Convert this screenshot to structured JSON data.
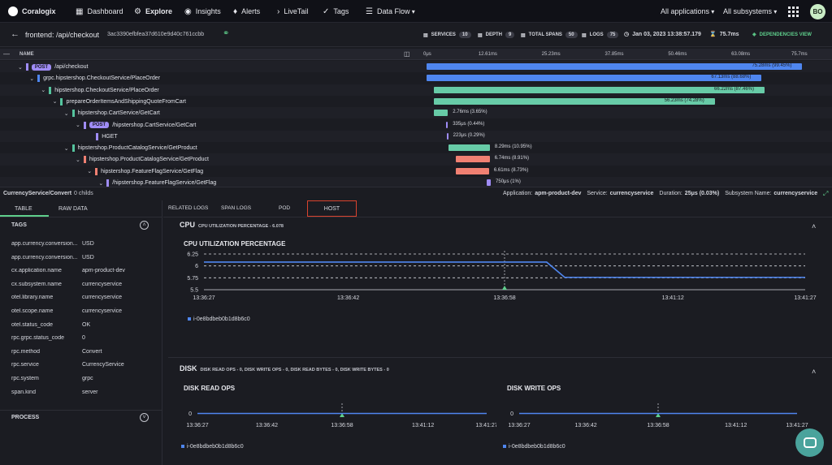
{
  "nav": {
    "brand": "Coralogix",
    "items": [
      "Dashboard",
      "Explore",
      "Insights",
      "Alerts",
      "LiveTail",
      "Tags",
      "Data Flow"
    ],
    "app_select": "All applications",
    "subsys_select": "All subsystems",
    "avatar": "BO"
  },
  "trace": {
    "title": "frontend: /api/checkout",
    "trace_id": "3ac3390efbfea37d610e9d40c761ccbb",
    "services_label": "SERVICES",
    "services": "10",
    "depth_label": "DEPTH",
    "depth": "9",
    "spans_label": "TOTAL SPANS",
    "spans": "50",
    "logs_label": "LOGS",
    "logs": "75",
    "date": "Jan 03, 2023 13:38:57.179",
    "duration": "75.7ms",
    "deps_view": "DEPENDENCIES VIEW"
  },
  "timeline": {
    "name_header": "NAME",
    "ticks": [
      "0μs",
      "12.61ms",
      "25.23ms",
      "37.85ms",
      "50.46ms",
      "63.08ms",
      "75.7ms"
    ],
    "rows": [
      {
        "name": "/api/checkout",
        "method": "POST",
        "color": "#9f8cf5",
        "indent": 0,
        "start": 0.0,
        "width": 0.9945,
        "bar": "#4f86ef",
        "label": "75.28ms (99.45%)",
        "label_inside": true,
        "chevron": true
      },
      {
        "name": "grpc.hipstershop.CheckoutService/PlaceOrder",
        "color": "#4f86ef",
        "indent": 1,
        "start": 0.0,
        "width": 0.8868,
        "bar": "#4f86ef",
        "label": "67.13ms (88.68%)",
        "label_inside": true,
        "chevron": true
      },
      {
        "name": "hipstershop.CheckoutService/PlaceOrder",
        "color": "#55c49e",
        "indent": 2,
        "start": 0.02,
        "width": 0.8746,
        "bar": "#67cba7",
        "label": "66.22ms (87.46%)",
        "label_inside": true,
        "chevron": true
      },
      {
        "name": "prepareOrderItemsAndShippingQuoteFromCart",
        "color": "#55c49e",
        "indent": 3,
        "start": 0.02,
        "width": 0.7428,
        "bar": "#67cba7",
        "label": "56.23ms (74.28%)",
        "label_inside": true,
        "chevron": true
      },
      {
        "name": "hipstershop.CartService/GetCart",
        "color": "#55c49e",
        "indent": 4,
        "start": 0.02,
        "width": 0.0365,
        "bar": "#67cba7",
        "label": "2.76ms (3.65%)",
        "label_inside": false,
        "chevron": true
      },
      {
        "name": "/hipstershop.CartService/GetCart",
        "method": "POST",
        "color": "#9f8cf5",
        "indent": 5,
        "start": 0.052,
        "width": 0.0044,
        "bar": "#9f8cf5",
        "label": "335μs (0.44%)",
        "label_inside": false,
        "chevron": true
      },
      {
        "name": "HGET",
        "color": "#9f8cf5",
        "indent": 6,
        "start": 0.053,
        "width": 0.0029,
        "bar": "#9f8cf5",
        "label": "223μs (0.29%)",
        "label_inside": false,
        "chevron": false
      },
      {
        "name": "hipstershop.ProductCatalogService/GetProduct",
        "color": "#55c49e",
        "indent": 4,
        "start": 0.058,
        "width": 0.1095,
        "bar": "#67cba7",
        "label": "8.29ms (10.95%)",
        "label_inside": false,
        "chevron": true
      },
      {
        "name": "hipstershop.ProductCatalogService/GetProduct",
        "color": "#f08072",
        "indent": 5,
        "start": 0.078,
        "width": 0.0891,
        "bar": "#f08072",
        "label": "6.74ms (8.91%)",
        "label_inside": false,
        "chevron": true
      },
      {
        "name": "hipstershop.FeatureFlagService/GetFlag",
        "color": "#f08072",
        "indent": 6,
        "start": 0.078,
        "width": 0.0873,
        "bar": "#f08072",
        "label": "6.61ms (8.73%)",
        "label_inside": false,
        "chevron": true
      },
      {
        "name": "/hipstershop.FeatureFlagService/GetFlag",
        "color": "#9f8cf5",
        "indent": 7,
        "start": 0.16,
        "width": 0.01,
        "bar": "#9f8cf5",
        "label": "750μs (1%)",
        "label_inside": false,
        "chevron": true
      }
    ]
  },
  "info": {
    "span": "CurrencyService/Convert",
    "childs": "0 childs",
    "app_label": "Application:",
    "app": "apm-product-dev",
    "svc_label": "Service:",
    "svc": "currencyservice",
    "dur_label": "Duration:",
    "dur": "25μs (0.03%)",
    "sub_label": "Subsystem Name:",
    "sub": "currencyservice"
  },
  "left": {
    "tabs": [
      "TABLE",
      "RAW DATA"
    ],
    "tags_title": "TAGS",
    "tags": [
      {
        "k": "app.currency.conversion...",
        "v": "USD"
      },
      {
        "k": "app.currency.conversion...",
        "v": "USD"
      },
      {
        "k": "cx.application.name",
        "v": "apm-product-dev"
      },
      {
        "k": "cx.subsystem.name",
        "v": "currencyservice"
      },
      {
        "k": "otel.library.name",
        "v": "currencyservice"
      },
      {
        "k": "otel.scope.name",
        "v": "currencyservice"
      },
      {
        "k": "otel.status_code",
        "v": "OK"
      },
      {
        "k": "rpc.grpc.status_code",
        "v": "0"
      },
      {
        "k": "rpc.method",
        "v": "Convert"
      },
      {
        "k": "rpc.service",
        "v": "CurrencyService"
      },
      {
        "k": "rpc.system",
        "v": "grpc"
      },
      {
        "k": "span.kind",
        "v": "server"
      }
    ],
    "process_title": "PROCESS"
  },
  "right": {
    "tabs": [
      "RELATED LOGS",
      "SPAN LOGS",
      "POD",
      "HOST"
    ],
    "cpu": {
      "title": "CPU",
      "subtitle": "CPU UTILIZATION PERCENTAGE - 6.078",
      "chart_title": "CPU UTILIZATION PERCENTAGE"
    },
    "disk": {
      "title": "DISK",
      "subtitle": "DISK READ OPS - 0, DISK WRITE OPS - 0, DISK READ BYTES - 0, DISK WRITE BYTES - 0",
      "read_title": "DISK READ OPS",
      "write_title": "DISK WRITE OPS"
    }
  },
  "chart_data": [
    {
      "type": "line",
      "title": "CPU UTILIZATION PERCENTAGE",
      "x": [
        "13:36:27",
        "13:36:42",
        "13:36:58",
        "13:41:12",
        "13:41:27"
      ],
      "yticks": [
        6.25,
        6,
        5.75,
        5.5
      ],
      "ylim": [
        5.5,
        6.25
      ],
      "series": [
        {
          "name": "i-0e8bdbeb0b1d8b6c0",
          "points": [
            [
              0,
              6.08
            ],
            [
              0.57,
              6.08
            ],
            [
              0.6,
              5.76
            ],
            [
              1,
              5.76
            ]
          ]
        }
      ],
      "marker_x": 0.5,
      "grid": true
    },
    {
      "type": "line",
      "title": "DISK READ OPS",
      "x": [
        "13:36:27",
        "13:36:42",
        "13:36:58",
        "13:41:12",
        "13:41:27"
      ],
      "yticks": [
        0
      ],
      "series": [
        {
          "name": "i-0e8bdbeb0b1d8b6c0",
          "points": [
            [
              0,
              0
            ],
            [
              1,
              0
            ]
          ]
        }
      ],
      "marker_x": 0.5
    },
    {
      "type": "line",
      "title": "DISK WRITE OPS",
      "x": [
        "13:36:27",
        "13:36:42",
        "13:36:58",
        "13:41:12",
        "13:41:27"
      ],
      "yticks": [
        0
      ],
      "series": [
        {
          "name": "i-0e8bdbeb0b1d8b6c0",
          "points": [
            [
              0,
              0
            ],
            [
              1,
              0
            ]
          ]
        }
      ],
      "marker_x": 0.5
    }
  ]
}
